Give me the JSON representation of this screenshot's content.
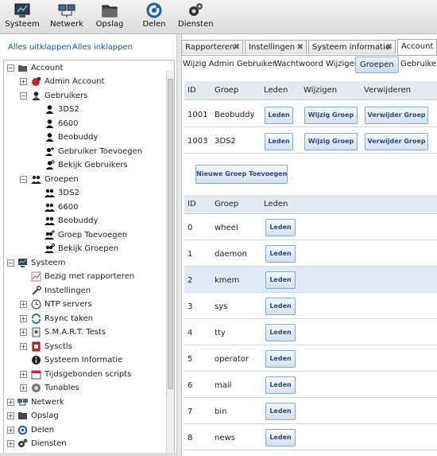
{
  "toolbar": {
    "items": [
      {
        "label": "Systeem",
        "icon": "system-icon"
      },
      {
        "label": "Netwerk",
        "icon": "network-icon"
      },
      {
        "label": "Opslag",
        "icon": "storage-icon"
      },
      {
        "label": "Delen",
        "icon": "sharing-icon"
      },
      {
        "label": "Diensten",
        "icon": "services-icon"
      }
    ]
  },
  "left": {
    "expand_all": "Alles uitklappen",
    "collapse_all": "Alles inklappen",
    "tree": [
      {
        "label": "Account",
        "icon": "folder-icon",
        "expander": "−"
      },
      {
        "label": "Admin Account",
        "icon": "admin-icon",
        "expander": "+"
      },
      {
        "label": "Gebruikers",
        "icon": "users-icon",
        "expander": "−"
      },
      {
        "label": "3DS2",
        "icon": "user-icon",
        "expander": ""
      },
      {
        "label": "6600",
        "icon": "user-icon",
        "expander": ""
      },
      {
        "label": "Beobuddy",
        "icon": "user-icon",
        "expander": ""
      },
      {
        "label": "Gebruiker Toevoegen",
        "icon": "add-user-icon",
        "expander": ""
      },
      {
        "label": "Bekijk Gebruikers",
        "icon": "view-users-icon",
        "expander": ""
      },
      {
        "label": "Groepen",
        "icon": "groups-icon",
        "expander": "−"
      },
      {
        "label": "3DS2",
        "icon": "group-icon",
        "expander": ""
      },
      {
        "label": "6600",
        "icon": "group-icon",
        "expander": ""
      },
      {
        "label": "Beobuddy",
        "icon": "group-icon",
        "expander": ""
      },
      {
        "label": "Groep Toevoegen",
        "icon": "add-group-icon",
        "expander": ""
      },
      {
        "label": "Bekijk Groepen",
        "icon": "view-groups-icon",
        "expander": ""
      },
      {
        "label": "Systeem",
        "icon": "system-icon",
        "expander": "−"
      },
      {
        "label": "Bezig met rapporteren",
        "icon": "report-icon",
        "expander": ""
      },
      {
        "label": "Instellingen",
        "icon": "settings-icon",
        "expander": ""
      },
      {
        "label": "NTP servers",
        "icon": "clock-icon",
        "expander": "+"
      },
      {
        "label": "Rsync taken",
        "icon": "sync-icon",
        "expander": "+"
      },
      {
        "label": "S.M.A.R.T. Tests",
        "icon": "smart-icon",
        "expander": "+"
      },
      {
        "label": "Sysctls",
        "icon": "sysctl-icon",
        "expander": "+"
      },
      {
        "label": "Systeem Informatie",
        "icon": "info-icon",
        "expander": ""
      },
      {
        "label": "Tijdsgebonden scripts",
        "icon": "calendar-icon",
        "expander": "+"
      },
      {
        "label": "Tunables",
        "icon": "tunables-icon",
        "expander": "+"
      },
      {
        "label": "Netwerk",
        "icon": "network-icon",
        "expander": "+"
      },
      {
        "label": "Opslag",
        "icon": "storage-icon",
        "expander": "+"
      },
      {
        "label": "Delen",
        "icon": "sharing-icon",
        "expander": "+"
      },
      {
        "label": "Diensten",
        "icon": "services-icon",
        "expander": "+"
      }
    ]
  },
  "tabs": [
    {
      "label": "Rapporteren"
    },
    {
      "label": "Instellingen"
    },
    {
      "label": "Systeem informatie"
    },
    {
      "label": "Account"
    }
  ],
  "subtabs": [
    {
      "label": "Wijzig Admin Gebruiker"
    },
    {
      "label": "Wachtwoord Wijzigen"
    },
    {
      "label": "Groepen"
    },
    {
      "label": "Gebruiker"
    }
  ],
  "groups_table": {
    "headers": [
      "ID",
      "Groep",
      "Leden",
      "Wijzigen",
      "Verwijderen"
    ],
    "rows": [
      {
        "id": "1001",
        "group": "Beobuddy",
        "members": "Leden",
        "edit": "Wijzig Groep",
        "delete": "Verwijder Groep"
      },
      {
        "id": "1003",
        "group": "3DS2",
        "members": "Leden",
        "edit": "Wijzig Groep",
        "delete": "Verwijder Groep"
      }
    ],
    "add_button": "Nieuwe Groep Toevoegen"
  },
  "builtin_table": {
    "headers": [
      "ID",
      "Groep",
      "Leden"
    ],
    "rows": [
      {
        "id": "0",
        "group": "wheel",
        "members": "Leden"
      },
      {
        "id": "1",
        "group": "daemon",
        "members": "Leden"
      },
      {
        "id": "2",
        "group": "kmem",
        "members": "Leden"
      },
      {
        "id": "3",
        "group": "sys",
        "members": "Leden"
      },
      {
        "id": "4",
        "group": "tty",
        "members": "Leden"
      },
      {
        "id": "5",
        "group": "operator",
        "members": "Leden"
      },
      {
        "id": "6",
        "group": "mail",
        "members": "Leden"
      },
      {
        "id": "7",
        "group": "bin",
        "members": "Leden"
      },
      {
        "id": "8",
        "group": "news",
        "members": "Leden"
      }
    ]
  }
}
